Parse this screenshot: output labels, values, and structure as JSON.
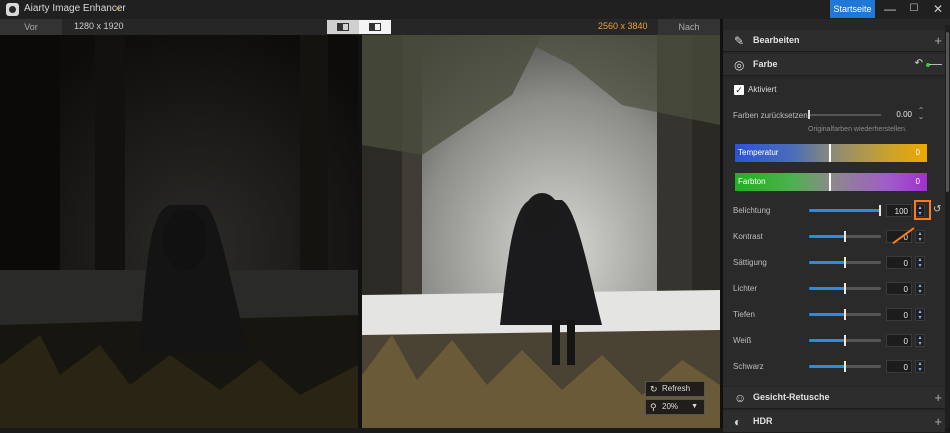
{
  "titlebar": {
    "app_title": "Aiarty Image Enhancer",
    "home_label": "Startseite",
    "minimize": "—",
    "maximize": "☐",
    "close": "✕"
  },
  "compare": {
    "before_label": "Vor",
    "before_resolution": "1280 x 1920",
    "after_resolution": "2560 x 3840",
    "after_label": "Nach"
  },
  "viewer": {
    "refresh_label": "Refresh",
    "zoom_value": "20%"
  },
  "panel": {
    "bearbeiten_label": "Bearbeiten",
    "farbe_label": "Farbe",
    "aktiviert_label": "Aktiviert",
    "aktiviert_checked": true,
    "reset_colors_label": "Farben zurücksetzen",
    "reset_colors_value": "0.00",
    "reset_hint": "Originalfarben wiederherstellen.",
    "temperatur_label": "Temperatur",
    "temperatur_value": "0",
    "farbton_label": "Farbton",
    "farbton_value": "0",
    "sliders": [
      {
        "label": "Belichtung",
        "value": "100",
        "level": 1.0
      },
      {
        "label": "Kontrast",
        "value": "0",
        "level": 0.5
      },
      {
        "label": "Sättigung",
        "value": "0",
        "level": 0.5
      },
      {
        "label": "Lichter",
        "value": "0",
        "level": 0.5
      },
      {
        "label": "Tiefen",
        "value": "0",
        "level": 0.5
      },
      {
        "label": "Weiß",
        "value": "0",
        "level": 0.5
      },
      {
        "label": "Schwarz",
        "value": "0",
        "level": 0.5
      }
    ],
    "gesicht_label": "Gesicht-Retusche",
    "hdr_label": "HDR"
  },
  "colors": {
    "accent_blue": "#1f78d6",
    "accent_orange": "#e8a33a",
    "highlight": "#ff7a1a",
    "active_dot": "#3cc43c"
  },
  "icons": {
    "app": "aiarty-logo-icon",
    "chevron": "chevron-down-icon",
    "refresh": "refresh-icon",
    "zoom": "magnifier-icon",
    "edit": "edit-icon",
    "color": "palette-icon",
    "face": "face-icon",
    "hdr": "hdr-icon",
    "undo": "undo-icon",
    "reset": "reset-icon"
  }
}
